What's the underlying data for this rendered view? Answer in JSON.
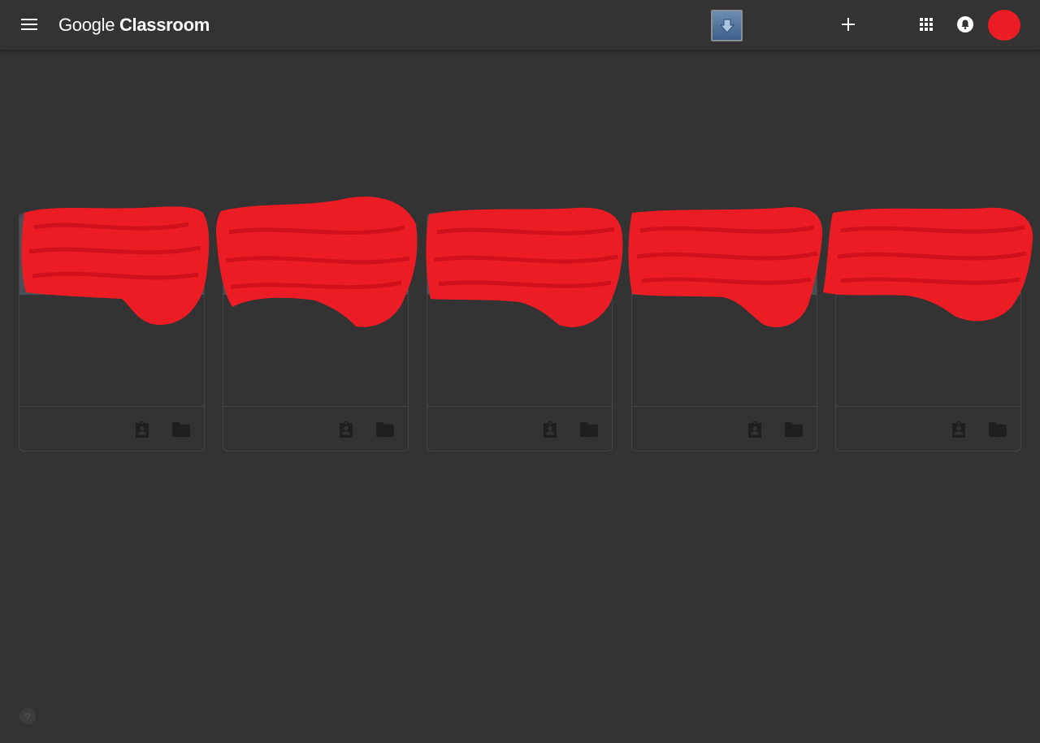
{
  "app": {
    "brand": "Google",
    "product": "Classroom"
  },
  "header": {
    "icons": [
      "menu-icon",
      "extension-download-icon",
      "plus-icon",
      "apps-grid-icon",
      "notifications-icon",
      "account-avatar"
    ]
  },
  "cards": [
    {
      "header_color": "#4a4f55",
      "footer_icons": [
        "assignment-ind-icon",
        "folder-icon"
      ]
    },
    {
      "header_color": "#4a4f55",
      "footer_icons": [
        "assignment-ind-icon",
        "folder-icon"
      ]
    },
    {
      "header_color": "#4a4f55",
      "footer_icons": [
        "assignment-ind-icon",
        "folder-icon"
      ]
    },
    {
      "header_color": "#4a4f55",
      "footer_icons": [
        "assignment-ind-icon",
        "folder-icon"
      ]
    },
    {
      "header_color": "#4a4f55",
      "footer_icons": [
        "assignment-ind-icon",
        "folder-icon"
      ]
    }
  ],
  "help": {
    "label": "?"
  },
  "colors": {
    "background": "#333333",
    "redaction": "#ec1c24",
    "icon": "#1f1f1f"
  }
}
